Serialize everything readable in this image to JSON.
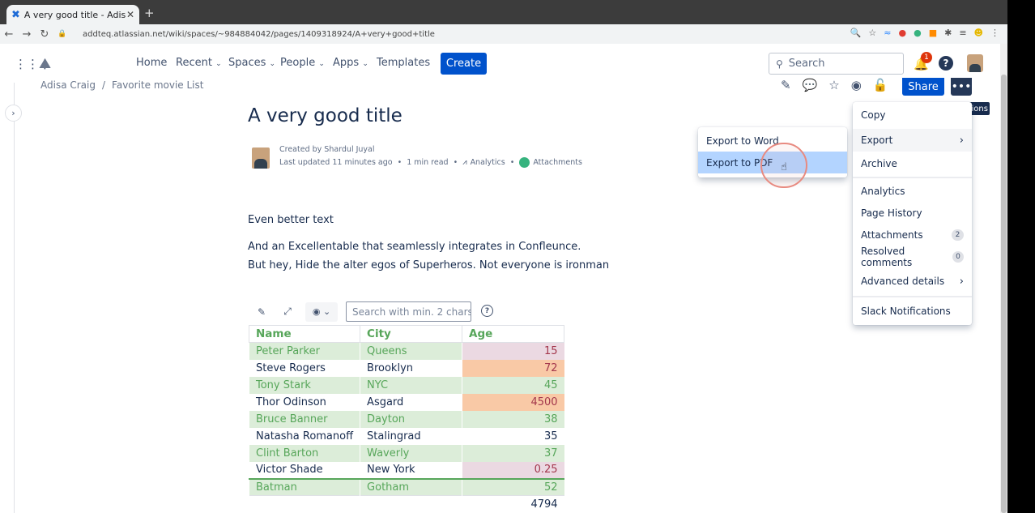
{
  "browser": {
    "tab_title": "A very good title - Adisa C",
    "tab_close": "✕",
    "new_tab": "+",
    "url": "addteq.atlassian.net/wiki/spaces/~984884042/pages/1409318924/A+very+good+title"
  },
  "nav": {
    "items": [
      "Home",
      "Recent",
      "Spaces",
      "People",
      "Apps",
      "Templates"
    ],
    "create_label": "Create",
    "search_placeholder": "Search",
    "notification_count": "1",
    "help_glyph": "?"
  },
  "breadcrumb": [
    "Adisa Craig",
    "Favorite movie List"
  ],
  "breadcrumb_sep": "/",
  "page_actions": {
    "share_label": "Share",
    "more_label": "•••",
    "tooltip": "More actions"
  },
  "page": {
    "title": "A very good title",
    "created_by": "Created by Shardul Juyal",
    "last_updated": "Last updated 11 minutes ago",
    "read_time": "1 min read",
    "analytics_label": "Analytics",
    "attachments_label": "Attachments",
    "body_line_1": "Even better text",
    "body_line_2": "And an Excellentable that seamlessly integrates in Confleunce.",
    "body_line_3": "But hey, Hide the alter egos of Superheros. Not everyone is ironman"
  },
  "table_toolbar": {
    "search_placeholder": "Search with min. 2 chars",
    "help_glyph": "?"
  },
  "table": {
    "headers": [
      "Name",
      "City",
      "Age"
    ],
    "rows": [
      {
        "name": "Peter Parker",
        "city": "Queens",
        "age": "15"
      },
      {
        "name": "Steve Rogers",
        "city": "Brooklyn",
        "age": "72"
      },
      {
        "name": "Tony Stark",
        "city": "NYC",
        "age": "45"
      },
      {
        "name": "Thor Odinson",
        "city": "Asgard",
        "age": "4500"
      },
      {
        "name": "Bruce Banner",
        "city": "Dayton",
        "age": "38"
      },
      {
        "name": "Natasha Romanoff",
        "city": "Stalingrad",
        "age": "35"
      },
      {
        "name": "Clint Barton",
        "city": "Waverly",
        "age": "37"
      },
      {
        "name": "Victor Shade",
        "city": "New York",
        "age": "0.25"
      },
      {
        "name": "Batman",
        "city": "Gotham",
        "age": "52"
      }
    ],
    "total": "4794"
  },
  "export_submenu": {
    "word": "Export to Word",
    "pdf": "Export to PDF"
  },
  "more_menu": {
    "copy": "Copy",
    "export": "Export",
    "archive": "Archive",
    "analytics": "Analytics",
    "page_history": "Page History",
    "attachments": "Attachments",
    "attachments_count": "2",
    "resolved_comments": "Resolved comments",
    "resolved_count": "0",
    "advanced_details": "Advanced details",
    "slack": "Slack Notifications"
  },
  "colors": {
    "primary": "#0052cc",
    "green_text": "#57a65a",
    "green_row": "#dcedd9",
    "pink_cell": "#ebd9e2",
    "orange_cell": "#f9c9a6",
    "highlight": "#b3d4ff"
  }
}
